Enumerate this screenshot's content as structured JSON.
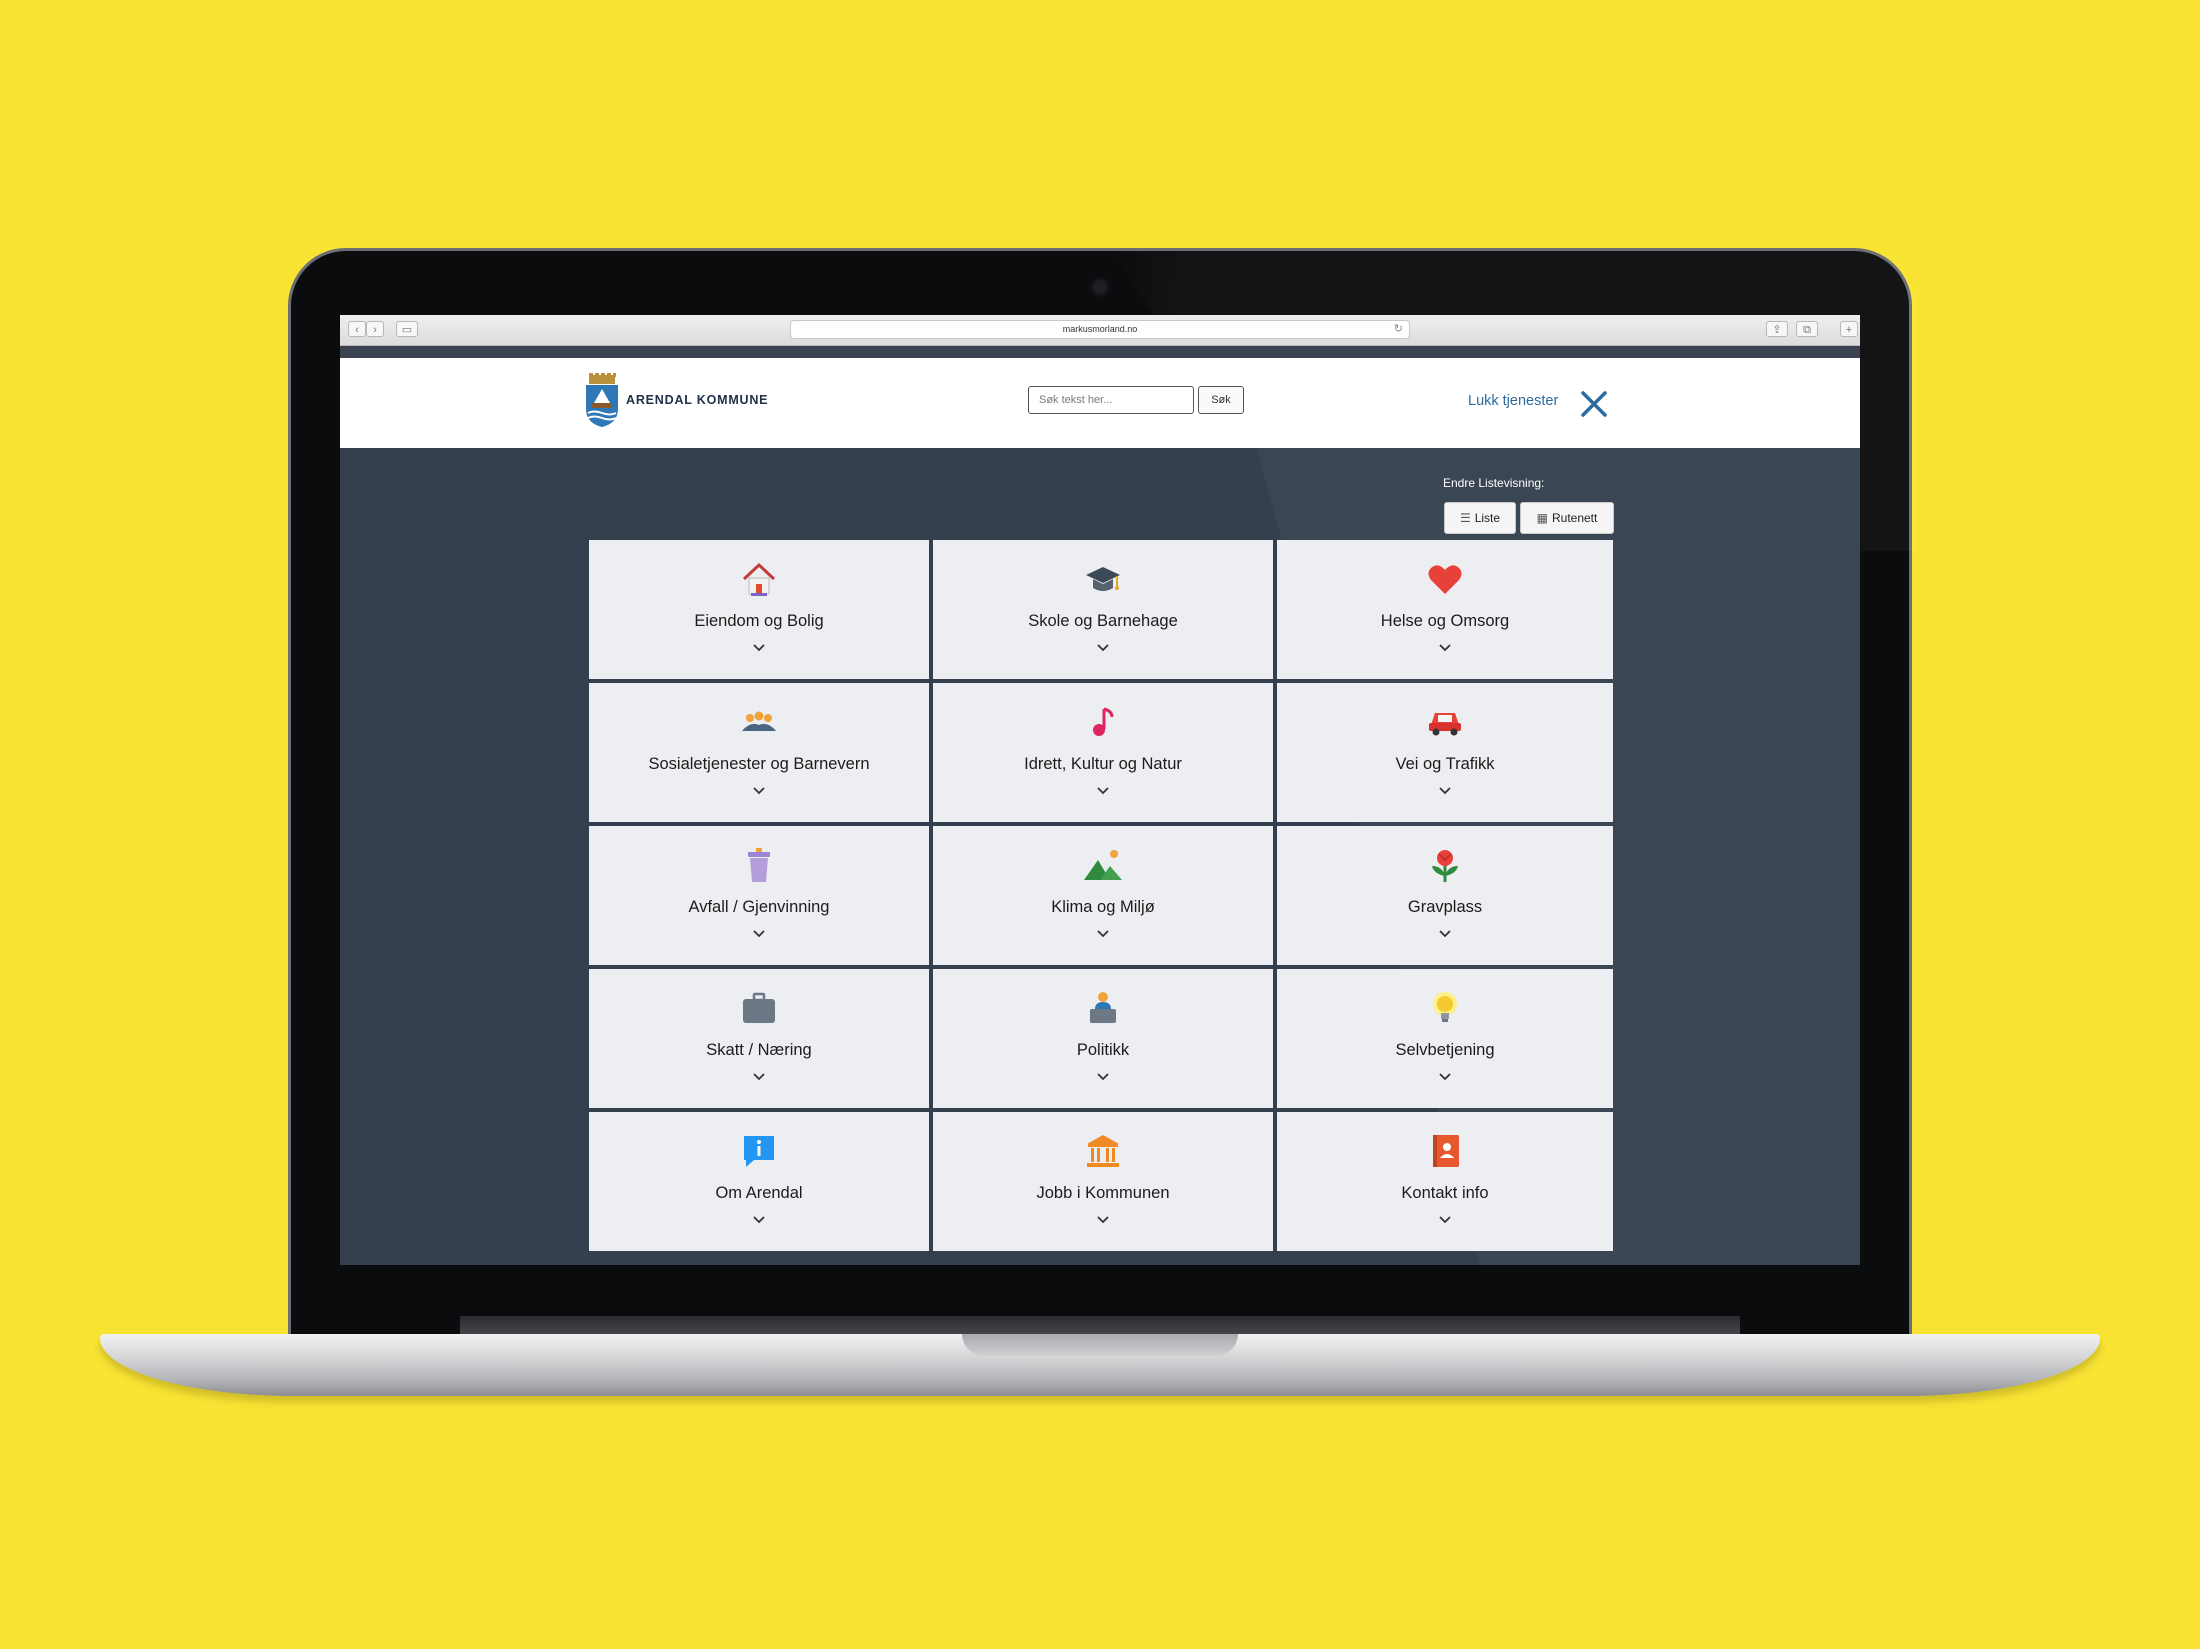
{
  "browser": {
    "url": "markusmorland.no"
  },
  "header": {
    "logo_text": "ARENDAL KOMMUNE",
    "search_placeholder": "Søk tekst her...",
    "search_button": "Søk",
    "close_label": "Lukk tjenester"
  },
  "view_toggle": {
    "label": "Endre Listevisning:",
    "list_label": "Liste",
    "grid_label": "Rutenett"
  },
  "tiles": [
    {
      "label": "Eiendom og Bolig",
      "icon": "house-icon"
    },
    {
      "label": "Skole og Barnehage",
      "icon": "graduation-cap-icon"
    },
    {
      "label": "Helse og Omsorg",
      "icon": "heart-icon"
    },
    {
      "label": "Sosialetjenester og Barnevern",
      "icon": "people-icon"
    },
    {
      "label": "Idrett, Kultur og Natur",
      "icon": "music-note-icon"
    },
    {
      "label": "Vei og Trafikk",
      "icon": "car-icon"
    },
    {
      "label": "Avfall / Gjenvinning",
      "icon": "trash-bin-icon"
    },
    {
      "label": "Klima og Miljø",
      "icon": "mountain-sun-icon"
    },
    {
      "label": "Gravplass",
      "icon": "flower-icon"
    },
    {
      "label": "Skatt / Næring",
      "icon": "briefcase-icon"
    },
    {
      "label": "Politikk",
      "icon": "speaker-podium-icon"
    },
    {
      "label": "Selvbetjening",
      "icon": "lightbulb-icon"
    },
    {
      "label": "Om Arendal",
      "icon": "info-bubble-icon"
    },
    {
      "label": "Jobb i Kommunen",
      "icon": "town-hall-icon"
    },
    {
      "label": "Kontakt info",
      "icon": "contact-book-icon"
    }
  ],
  "colors": {
    "background": "#f9e434",
    "screen_bg": "#34404e",
    "tile_bg": "#eceef1",
    "link": "#2d6b9e"
  }
}
